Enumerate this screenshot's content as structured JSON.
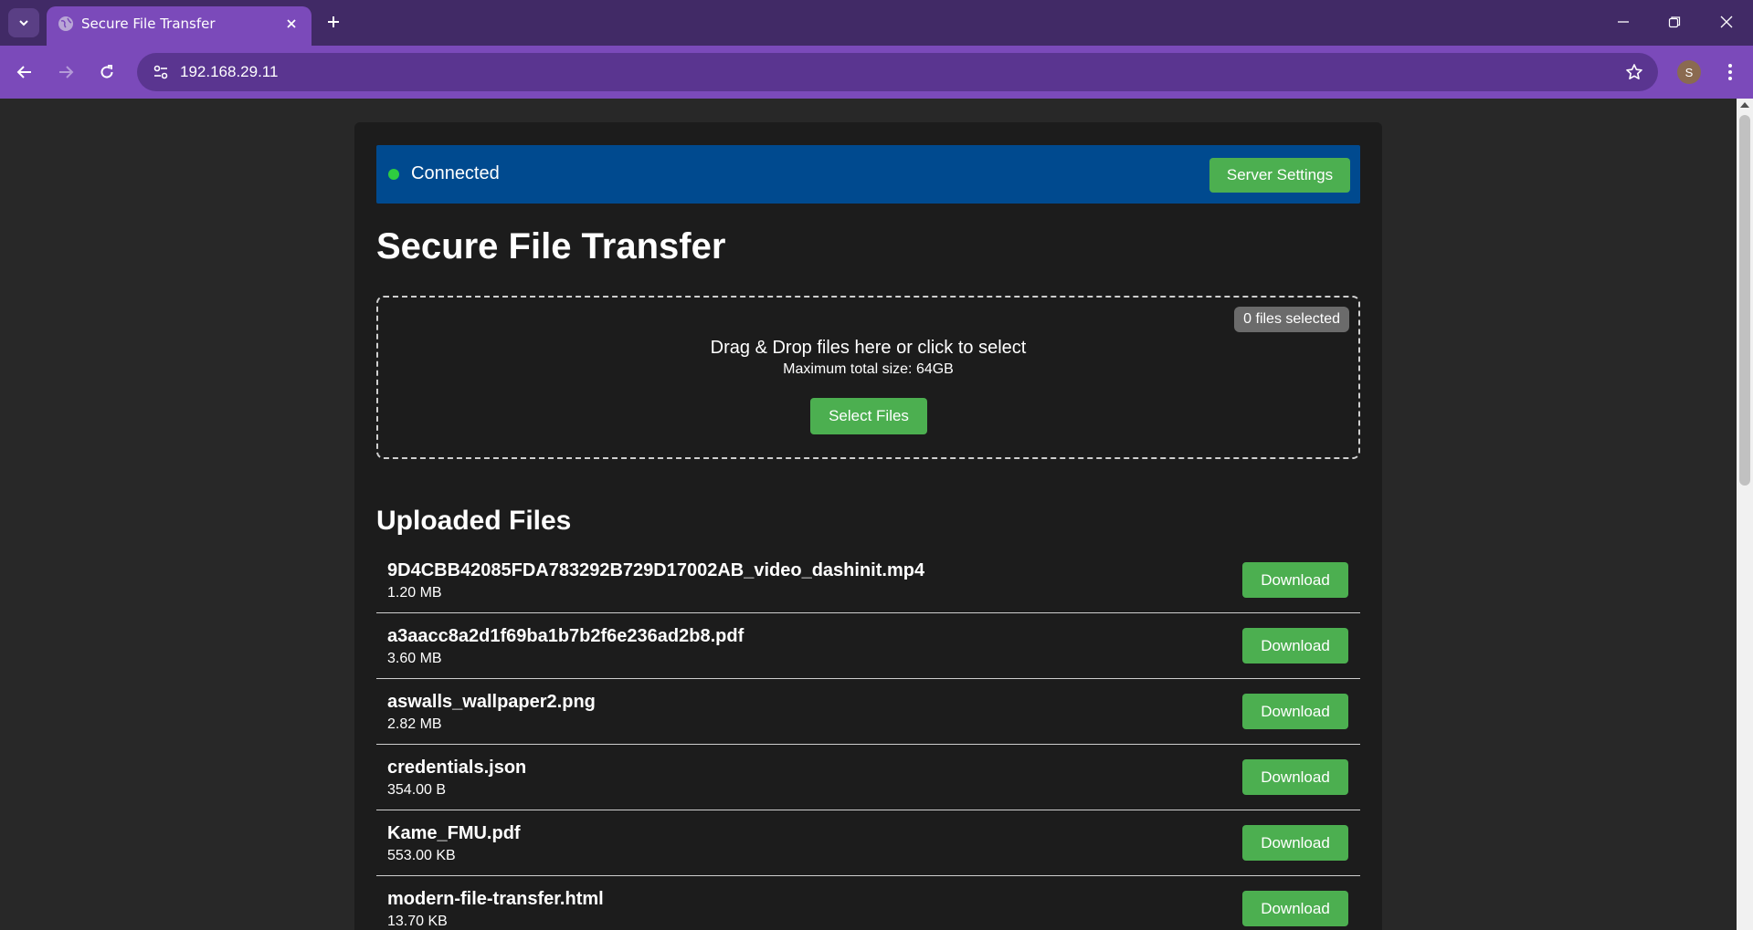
{
  "browser": {
    "tab_title": "Secure File Transfer",
    "url": "192.168.29.11",
    "profile_initial": "S"
  },
  "status": {
    "text": "Connected",
    "settings_label": "Server Settings"
  },
  "page": {
    "title": "Secure File Transfer"
  },
  "dropzone": {
    "file_count": "0 files selected",
    "text": "Drag & Drop files here or click to select",
    "subtext": "Maximum total size: 64GB",
    "select_label": "Select Files"
  },
  "uploaded": {
    "title": "Uploaded Files",
    "download_label": "Download",
    "files": [
      {
        "name": "9D4CBB42085FDA783292B729D17002AB_video_dashinit.mp4",
        "size": "1.20 MB"
      },
      {
        "name": "a3aacc8a2d1f69ba1b7b2f6e236ad2b8.pdf",
        "size": "3.60 MB"
      },
      {
        "name": "aswalls_wallpaper2.png",
        "size": "2.82 MB"
      },
      {
        "name": "credentials.json",
        "size": "354.00 B"
      },
      {
        "name": "Kame_FMU.pdf",
        "size": "553.00 KB"
      },
      {
        "name": "modern-file-transfer.html",
        "size": "13.70 KB"
      }
    ]
  },
  "colors": {
    "tab_bar": "#412a66",
    "toolbar": "#7b4aba",
    "status_bar": "#004a8f",
    "button_green": "#4caf50",
    "status_dot": "#2ecc40"
  }
}
